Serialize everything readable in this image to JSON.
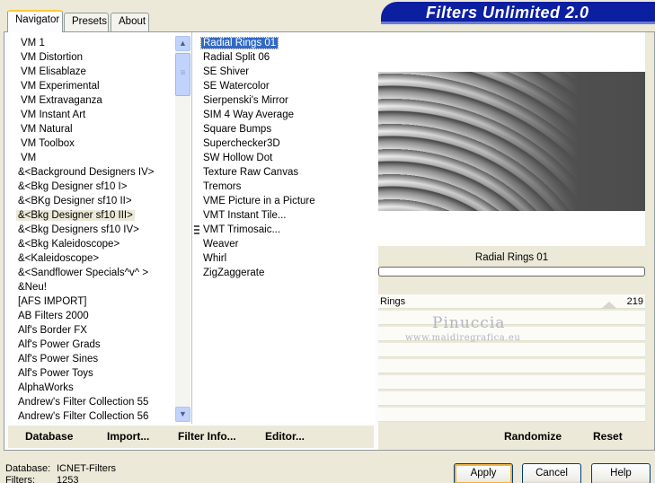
{
  "app": {
    "title": "Filters Unlimited 2.0"
  },
  "tabs": [
    {
      "label": "Navigator"
    },
    {
      "label": "Presets"
    },
    {
      "label": "About"
    }
  ],
  "categories": {
    "items": [
      "VM 1",
      "VM Distortion",
      "VM Elisablaze",
      "VM Experimental",
      "VM Extravaganza",
      "VM Instant Art",
      "VM Natural",
      "VM Toolbox",
      "VM",
      "&<Background Designers IV>",
      "&<Bkg Designer sf10 I>",
      "&<BKg Designer sf10 II>",
      "&<Bkg Designer sf10 III>",
      "&<Bkg Designers sf10 IV>",
      "&<Bkg Kaleidoscope>",
      "&<Kaleidoscope>",
      "&<Sandflower Specials^v^ >",
      "&Neu!",
      "[AFS IMPORT]",
      "AB Filters 2000",
      "Alf's Border FX",
      "Alf's Power Grads",
      "Alf's Power Sines",
      "Alf's Power Toys",
      "AlphaWorks",
      "Andrew's Filter Collection 55",
      "Andrew's Filter Collection 56"
    ]
  },
  "filters": {
    "items": [
      "Radial Rings 01",
      "Radial Split 06",
      "SE Shiver",
      "SE Watercolor",
      "Sierpenski's Mirror",
      "SIM 4 Way Average",
      "Square Bumps",
      "Superchecker3D",
      "SW Hollow Dot",
      "Texture Raw Canvas",
      "Tremors",
      "VME Picture in a Picture",
      "VMT Instant Tile...",
      "VMT Trimosaic...",
      "Weaver",
      "Whirl",
      "ZigZaggerate"
    ]
  },
  "preview": {
    "filter_name": "Radial Rings 01"
  },
  "params": {
    "rings_label": "Rings",
    "rings_value": "219"
  },
  "watermark": {
    "name": "Pinuccia",
    "site": "www.maidiregrafica.eu"
  },
  "toolbar": {
    "database_label": "Database",
    "import_label": "Import...",
    "filter_info_label": "Filter Info...",
    "editor_label": "Editor...",
    "randomize_label": "Randomize",
    "reset_label": "Reset"
  },
  "status": {
    "database_key": "Database:",
    "database_value": "ICNET-Filters",
    "filters_key": "Filters:",
    "filters_value": "1253"
  },
  "buttons": {
    "apply_label": "Apply",
    "cancel_label": "Cancel",
    "help_label": "Help"
  }
}
